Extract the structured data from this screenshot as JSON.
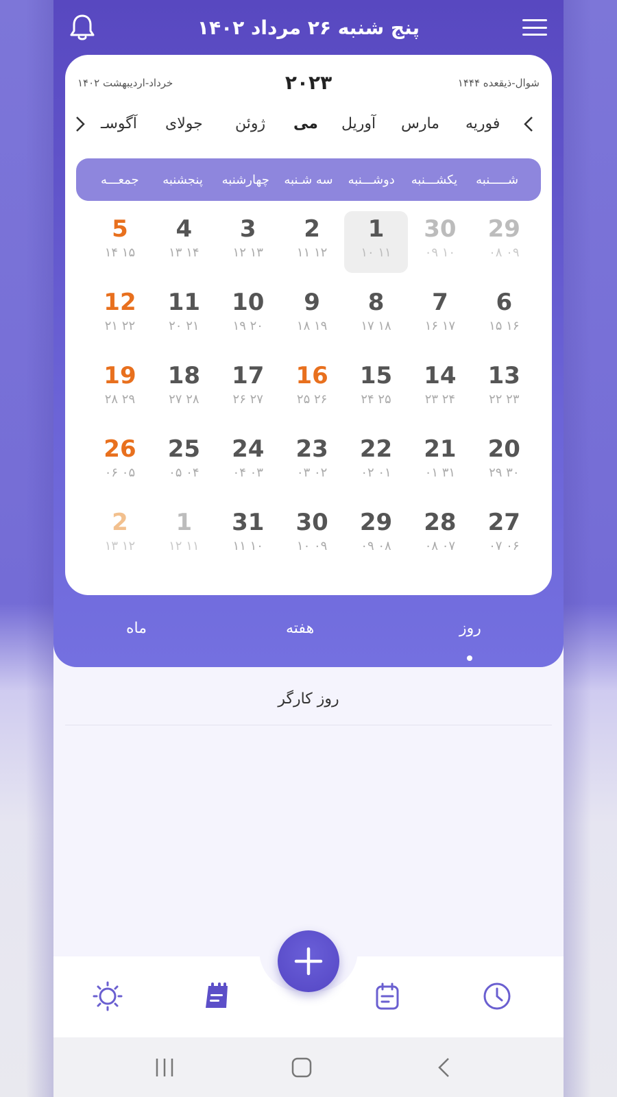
{
  "header": {
    "title": "پنج شنبه ۲۶ مرداد ۱۴۰۲"
  },
  "calendar": {
    "hijri_range": "شوال-ذیقعده ۱۴۴۴",
    "persian_range": "۱۴۰۲ خرداد-اردیبهشت",
    "year": "۲۰۲۳",
    "months": [
      "فوریه",
      "مارس",
      "آوریل",
      "می",
      "ژوئن",
      "جولای",
      "آگوسـ"
    ],
    "active_month": "می",
    "weekdays": [
      "شـــــنبه",
      "یکشـــنبه",
      "دوشـــنبه",
      "سه شـنبه",
      "چهارشنبه",
      "پنجشنبه",
      "جمعـــه"
    ],
    "weeks": [
      [
        {
          "g": "29",
          "p": "۰۸ ۰۹",
          "faded": true
        },
        {
          "g": "30",
          "p": "۰۹ ۱۰",
          "faded": true
        },
        {
          "g": "1",
          "p": "۱۰ ۱۱",
          "today": true
        },
        {
          "g": "2",
          "p": "۱۱ ۱۲"
        },
        {
          "g": "3",
          "p": "۱۲ ۱۳"
        },
        {
          "g": "4",
          "p": "۱۳ ۱۴"
        },
        {
          "g": "5",
          "p": "۱۴ ۱۵",
          "friday": true
        }
      ],
      [
        {
          "g": "6",
          "p": "۱۵ ۱۶"
        },
        {
          "g": "7",
          "p": "۱۶ ۱۷"
        },
        {
          "g": "8",
          "p": "۱۷ ۱۸"
        },
        {
          "g": "9",
          "p": "۱۸ ۱۹"
        },
        {
          "g": "10",
          "p": "۱۹ ۲۰"
        },
        {
          "g": "11",
          "p": "۲۰ ۲۱"
        },
        {
          "g": "12",
          "p": "۲۱ ۲۲",
          "friday": true
        }
      ],
      [
        {
          "g": "13",
          "p": "۲۲ ۲۳"
        },
        {
          "g": "14",
          "p": "۲۳ ۲۴"
        },
        {
          "g": "15",
          "p": "۲۴ ۲۵"
        },
        {
          "g": "16",
          "p": "۲۵ ۲۶",
          "friday": true
        },
        {
          "g": "17",
          "p": "۲۶ ۲۷"
        },
        {
          "g": "18",
          "p": "۲۷ ۲۸"
        },
        {
          "g": "19",
          "p": "۲۸ ۲۹",
          "friday": true
        }
      ],
      [
        {
          "g": "20",
          "p": "۲۹ ۳۰"
        },
        {
          "g": "21",
          "p": "۰۱ ۳۱"
        },
        {
          "g": "22",
          "p": "۰۲ ۰۱"
        },
        {
          "g": "23",
          "p": "۰۳ ۰۲"
        },
        {
          "g": "24",
          "p": "۰۴ ۰۳"
        },
        {
          "g": "25",
          "p": "۰۵ ۰۴"
        },
        {
          "g": "26",
          "p": "۰۶ ۰۵",
          "friday": true
        }
      ],
      [
        {
          "g": "27",
          "p": "۰۷ ۰۶"
        },
        {
          "g": "28",
          "p": "۰۸ ۰۷"
        },
        {
          "g": "29",
          "p": "۰۹ ۰۸"
        },
        {
          "g": "30",
          "p": "۱۰ ۰۹"
        },
        {
          "g": "31",
          "p": "۱۱ ۱۰"
        },
        {
          "g": "1",
          "p": "۱۲ ۱۱",
          "faded": true
        },
        {
          "g": "2",
          "p": "۱۳ ۱۲",
          "faded": true,
          "friday": true
        }
      ]
    ]
  },
  "view_tabs": {
    "day": "روز",
    "week": "هفته",
    "month": "ماه",
    "active": "day"
  },
  "events": [
    {
      "title": "روز کارگر"
    }
  ],
  "bottom_nav": {
    "items": [
      "clock-icon",
      "notes-icon",
      "add-icon",
      "calendar-icon",
      "weather-icon"
    ],
    "active": "calendar-icon"
  },
  "colors": {
    "primary": "#5c4fc8",
    "weekday_bar": "#8e86dd",
    "friday": "#e8701e",
    "friday_faded": "#f2c08e",
    "icon": "#6a5fd0"
  }
}
